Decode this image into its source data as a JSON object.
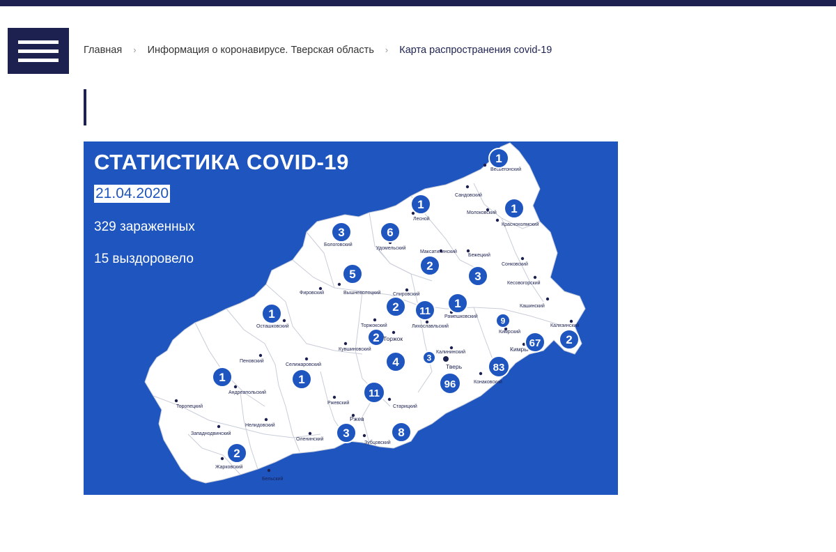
{
  "header": {
    "menu_icon": "hamburger-menu-icon",
    "colors": {
      "brand": "#1c2150",
      "map_bg": "#1f55bf",
      "map_fill": "#ffffff"
    }
  },
  "breadcrumb": {
    "home": "Главная",
    "section": "Информация о коронавирусе. Тверская область",
    "current": "Карта распространения covid-19"
  },
  "infographic": {
    "title": "СТАТИСТИКА COVID-19",
    "date": "21.04.2020",
    "infected": "329 зараженных",
    "recovered": "15 выздоровело"
  },
  "districts": [
    {
      "name": "Весьегонский",
      "count": "1"
    },
    {
      "name": "Сандовский",
      "count": ""
    },
    {
      "name": "Молоковский",
      "count": ""
    },
    {
      "name": "Краснохолмский",
      "count": "1"
    },
    {
      "name": "Лесной",
      "count": "1"
    },
    {
      "name": "Бологовский",
      "count": "3"
    },
    {
      "name": "Удомельский",
      "count": "6"
    },
    {
      "name": "Максатихинский",
      "count": "2"
    },
    {
      "name": "Бежецкий",
      "count": "3"
    },
    {
      "name": "Сонковский",
      "count": ""
    },
    {
      "name": "Кесовогорский",
      "count": ""
    },
    {
      "name": "Вышневолоцкий",
      "count": "5"
    },
    {
      "name": "Фировский",
      "count": ""
    },
    {
      "name": "Спировский",
      "count": "2"
    },
    {
      "name": "Лихославльский",
      "count": "11"
    },
    {
      "name": "Рамешковский",
      "count": "1"
    },
    {
      "name": "Кашинский",
      "count": ""
    },
    {
      "name": "Калязинский",
      "count": "2"
    },
    {
      "name": "Кимрский",
      "count": "9"
    },
    {
      "name": "Кимры",
      "count": "67"
    },
    {
      "name": "Осташковский",
      "count": "1"
    },
    {
      "name": "Торжокский",
      "count": "2"
    },
    {
      "name": "Торжок",
      "count": "4"
    },
    {
      "name": "Кувшиновский",
      "count": ""
    },
    {
      "name": "Калининский",
      "count": "3"
    },
    {
      "name": "Тверь",
      "count": "96"
    },
    {
      "name": "Конаковский",
      "count": "83"
    },
    {
      "name": "Пеновский",
      "count": ""
    },
    {
      "name": "Селижаровский",
      "count": "1"
    },
    {
      "name": "Андреапольский",
      "count": "1"
    },
    {
      "name": "Торопецкий",
      "count": ""
    },
    {
      "name": "Ржевский",
      "count": ""
    },
    {
      "name": "Старицкий",
      "count": "11"
    },
    {
      "name": "Ржев",
      "count": "3"
    },
    {
      "name": "Зубцовский",
      "count": "8"
    },
    {
      "name": "Оленинский",
      "count": ""
    },
    {
      "name": "Нелидовский",
      "count": ""
    },
    {
      "name": "Западнодвинский",
      "count": ""
    },
    {
      "name": "Жарковский",
      "count": "2"
    },
    {
      "name": "Бельский",
      "count": ""
    }
  ]
}
